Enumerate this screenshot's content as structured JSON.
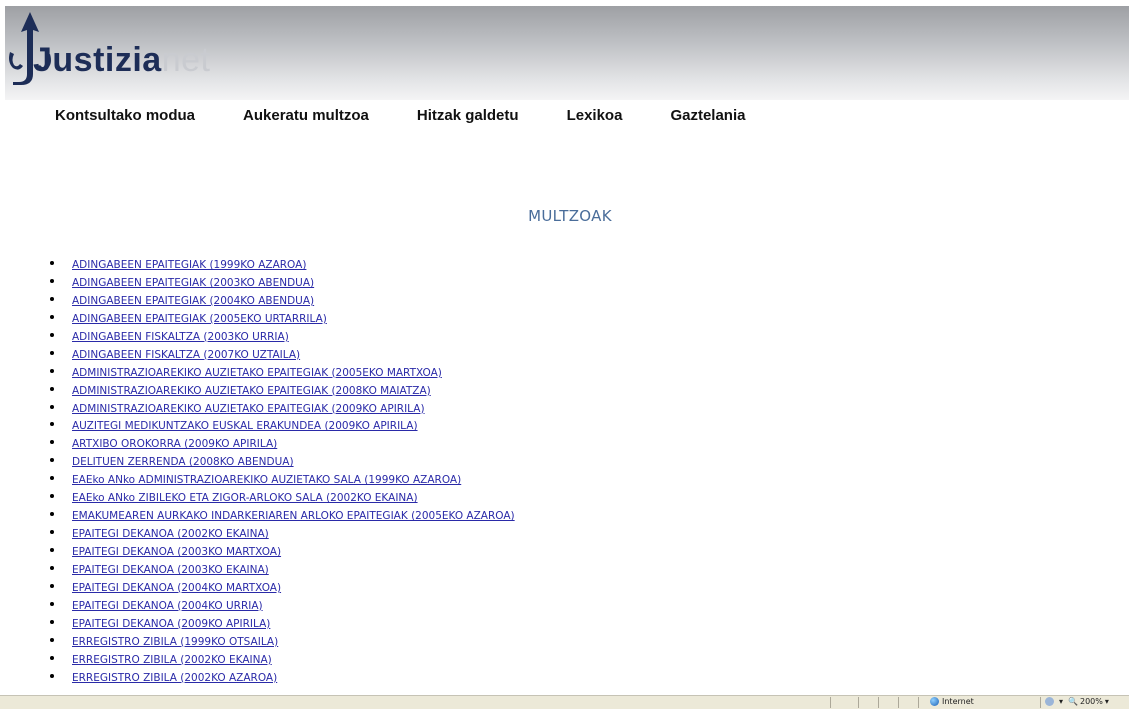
{
  "header": {
    "logo_part1": "Justizia",
    "logo_part2": "net"
  },
  "nav": [
    {
      "label": "Kontsultako modua"
    },
    {
      "label": "Aukeratu multzoa"
    },
    {
      "label": "Hitzak galdetu"
    },
    {
      "label": "Lexikoa"
    },
    {
      "label": "Gaztelania"
    }
  ],
  "main": {
    "title": "MULTZOAK",
    "items": [
      "ADINGABEEN EPAITEGIAK (1999KO AZAROA)",
      "ADINGABEEN EPAITEGIAK (2003KO ABENDUA)",
      "ADINGABEEN EPAITEGIAK (2004KO ABENDUA)",
      "ADINGABEEN EPAITEGIAK (2005EKO URTARRILA)",
      "ADINGABEEN FISKALTZA (2003KO URRIA)",
      "ADINGABEEN FISKALTZA (2007KO UZTAILA)",
      "ADMINISTRAZIOAREKIKO AUZIETAKO EPAITEGIAK (2005EKO MARTXOA)",
      "ADMINISTRAZIOAREKIKO AUZIETAKO EPAITEGIAK (2008KO MAIATZA)",
      "ADMINISTRAZIOAREKIKO AUZIETAKO EPAITEGIAK (2009KO APIRILA)",
      "AUZITEGI MEDIKUNTZAKO EUSKAL ERAKUNDEA (2009KO APIRILA)",
      "ARTXIBO OROKORRA (2009KO APIRILA)",
      "DELITUEN ZERRENDA (2008KO ABENDUA)",
      "EAEko ANko ADMINISTRAZIOAREKIKO AUZIETAKO SALA (1999KO AZAROA)",
      "EAEko ANko ZIBILEKO ETA ZIGOR-ARLOKO SALA (2002KO EKAINA)",
      "EMAKUMEAREN AURKAKO INDARKERIAREN ARLOKO EPAITEGIAK (2005EKO AZAROA)",
      "EPAITEGI DEKANOA (2002KO EKAINA)",
      "EPAITEGI DEKANOA (2003KO MARTXOA)",
      "EPAITEGI DEKANOA (2003KO EKAINA)",
      "EPAITEGI DEKANOA (2004KO MARTXOA)",
      "EPAITEGI DEKANOA (2004KO URRIA)",
      "EPAITEGI DEKANOA (2009KO APIRILA)",
      "ERREGISTRO ZIBILA (1999KO OTSAILA)",
      "ERREGISTRO ZIBILA (2002KO EKAINA)",
      "ERREGISTRO ZIBILA (2002KO AZAROA)"
    ]
  },
  "statusbar": {
    "zone": "Internet",
    "zoom": "200%"
  },
  "colors": {
    "link": "#2a2aa8",
    "title": "#4a6d9a",
    "logo_dark": "#1d2d57"
  }
}
